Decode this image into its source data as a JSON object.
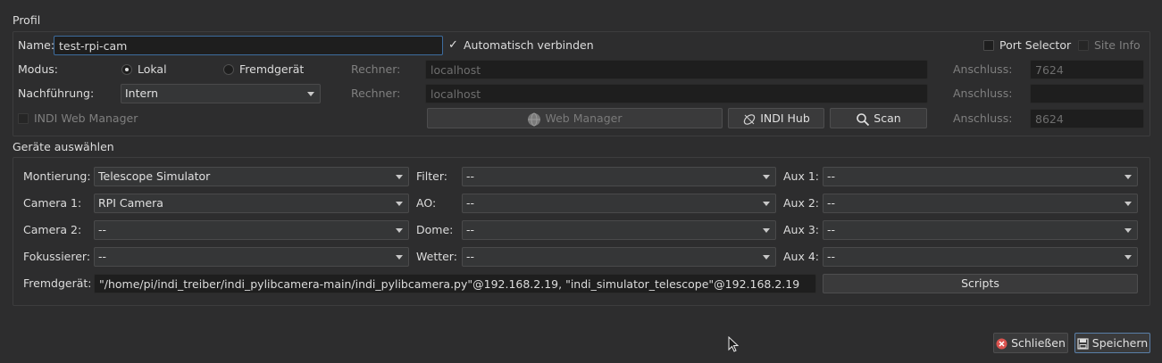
{
  "profile": {
    "title": "Profil",
    "name_label": "Name:",
    "name_value": "test-rpi-cam",
    "auto_connect_label": "Automatisch verbinden",
    "port_selector_label": "Port Selector",
    "site_info_label": "Site Info",
    "mode_label": "Modus:",
    "mode_local": "Lokal",
    "mode_remote": "Fremdgerät",
    "host_label": "Rechner:",
    "host_value": "localhost",
    "port_label": "Anschluss:",
    "port_value": "7624",
    "guiding_label": "Nachführung:",
    "guiding_value": "Intern",
    "guide_host_label": "Rechner:",
    "guide_host_value": "localhost",
    "guide_port_label": "Anschluss:",
    "guide_port_value": "",
    "indi_web_manager_label": "INDI Web Manager",
    "web_manager_button": "Web Manager",
    "indi_hub_button": "INDI Hub",
    "scan_button": "Scan",
    "web_port_label": "Anschluss:",
    "web_port_value": "8624"
  },
  "devices": {
    "title": "Geräte auswählen",
    "mount_label": "Montierung:",
    "mount_value": "Telescope Simulator",
    "camera1_label": "Camera 1:",
    "camera1_value": "RPI Camera",
    "camera2_label": "Camera 2:",
    "camera2_value": "--",
    "focuser_label": "Fokussierer:",
    "focuser_value": "--",
    "filter_label": "Filter:",
    "filter_value": "--",
    "ao_label": "AO:",
    "ao_value": "--",
    "dome_label": "Dome:",
    "dome_value": "--",
    "weather_label": "Wetter:",
    "weather_value": "--",
    "aux1_label": "Aux 1:",
    "aux1_value": "--",
    "aux2_label": "Aux 2:",
    "aux2_value": "--",
    "aux3_label": "Aux 3:",
    "aux3_value": "--",
    "aux4_label": "Aux 4:",
    "aux4_value": "--",
    "remote_label": "Fremdgerät:",
    "remote_value": "\"/home/pi/indi_treiber/indi_pylibcamera-main/indi_pylibcamera.py\"@192.168.2.19, \"indi_simulator_telescope\"@192.168.2.19",
    "scripts_button": "Scripts"
  },
  "footer": {
    "close_button": "Schließen",
    "save_button": "Speichern"
  },
  "colors": {
    "background": "#2d2d2e",
    "close_icon": "#d9534f",
    "focus_border": "#3d6c9e"
  }
}
